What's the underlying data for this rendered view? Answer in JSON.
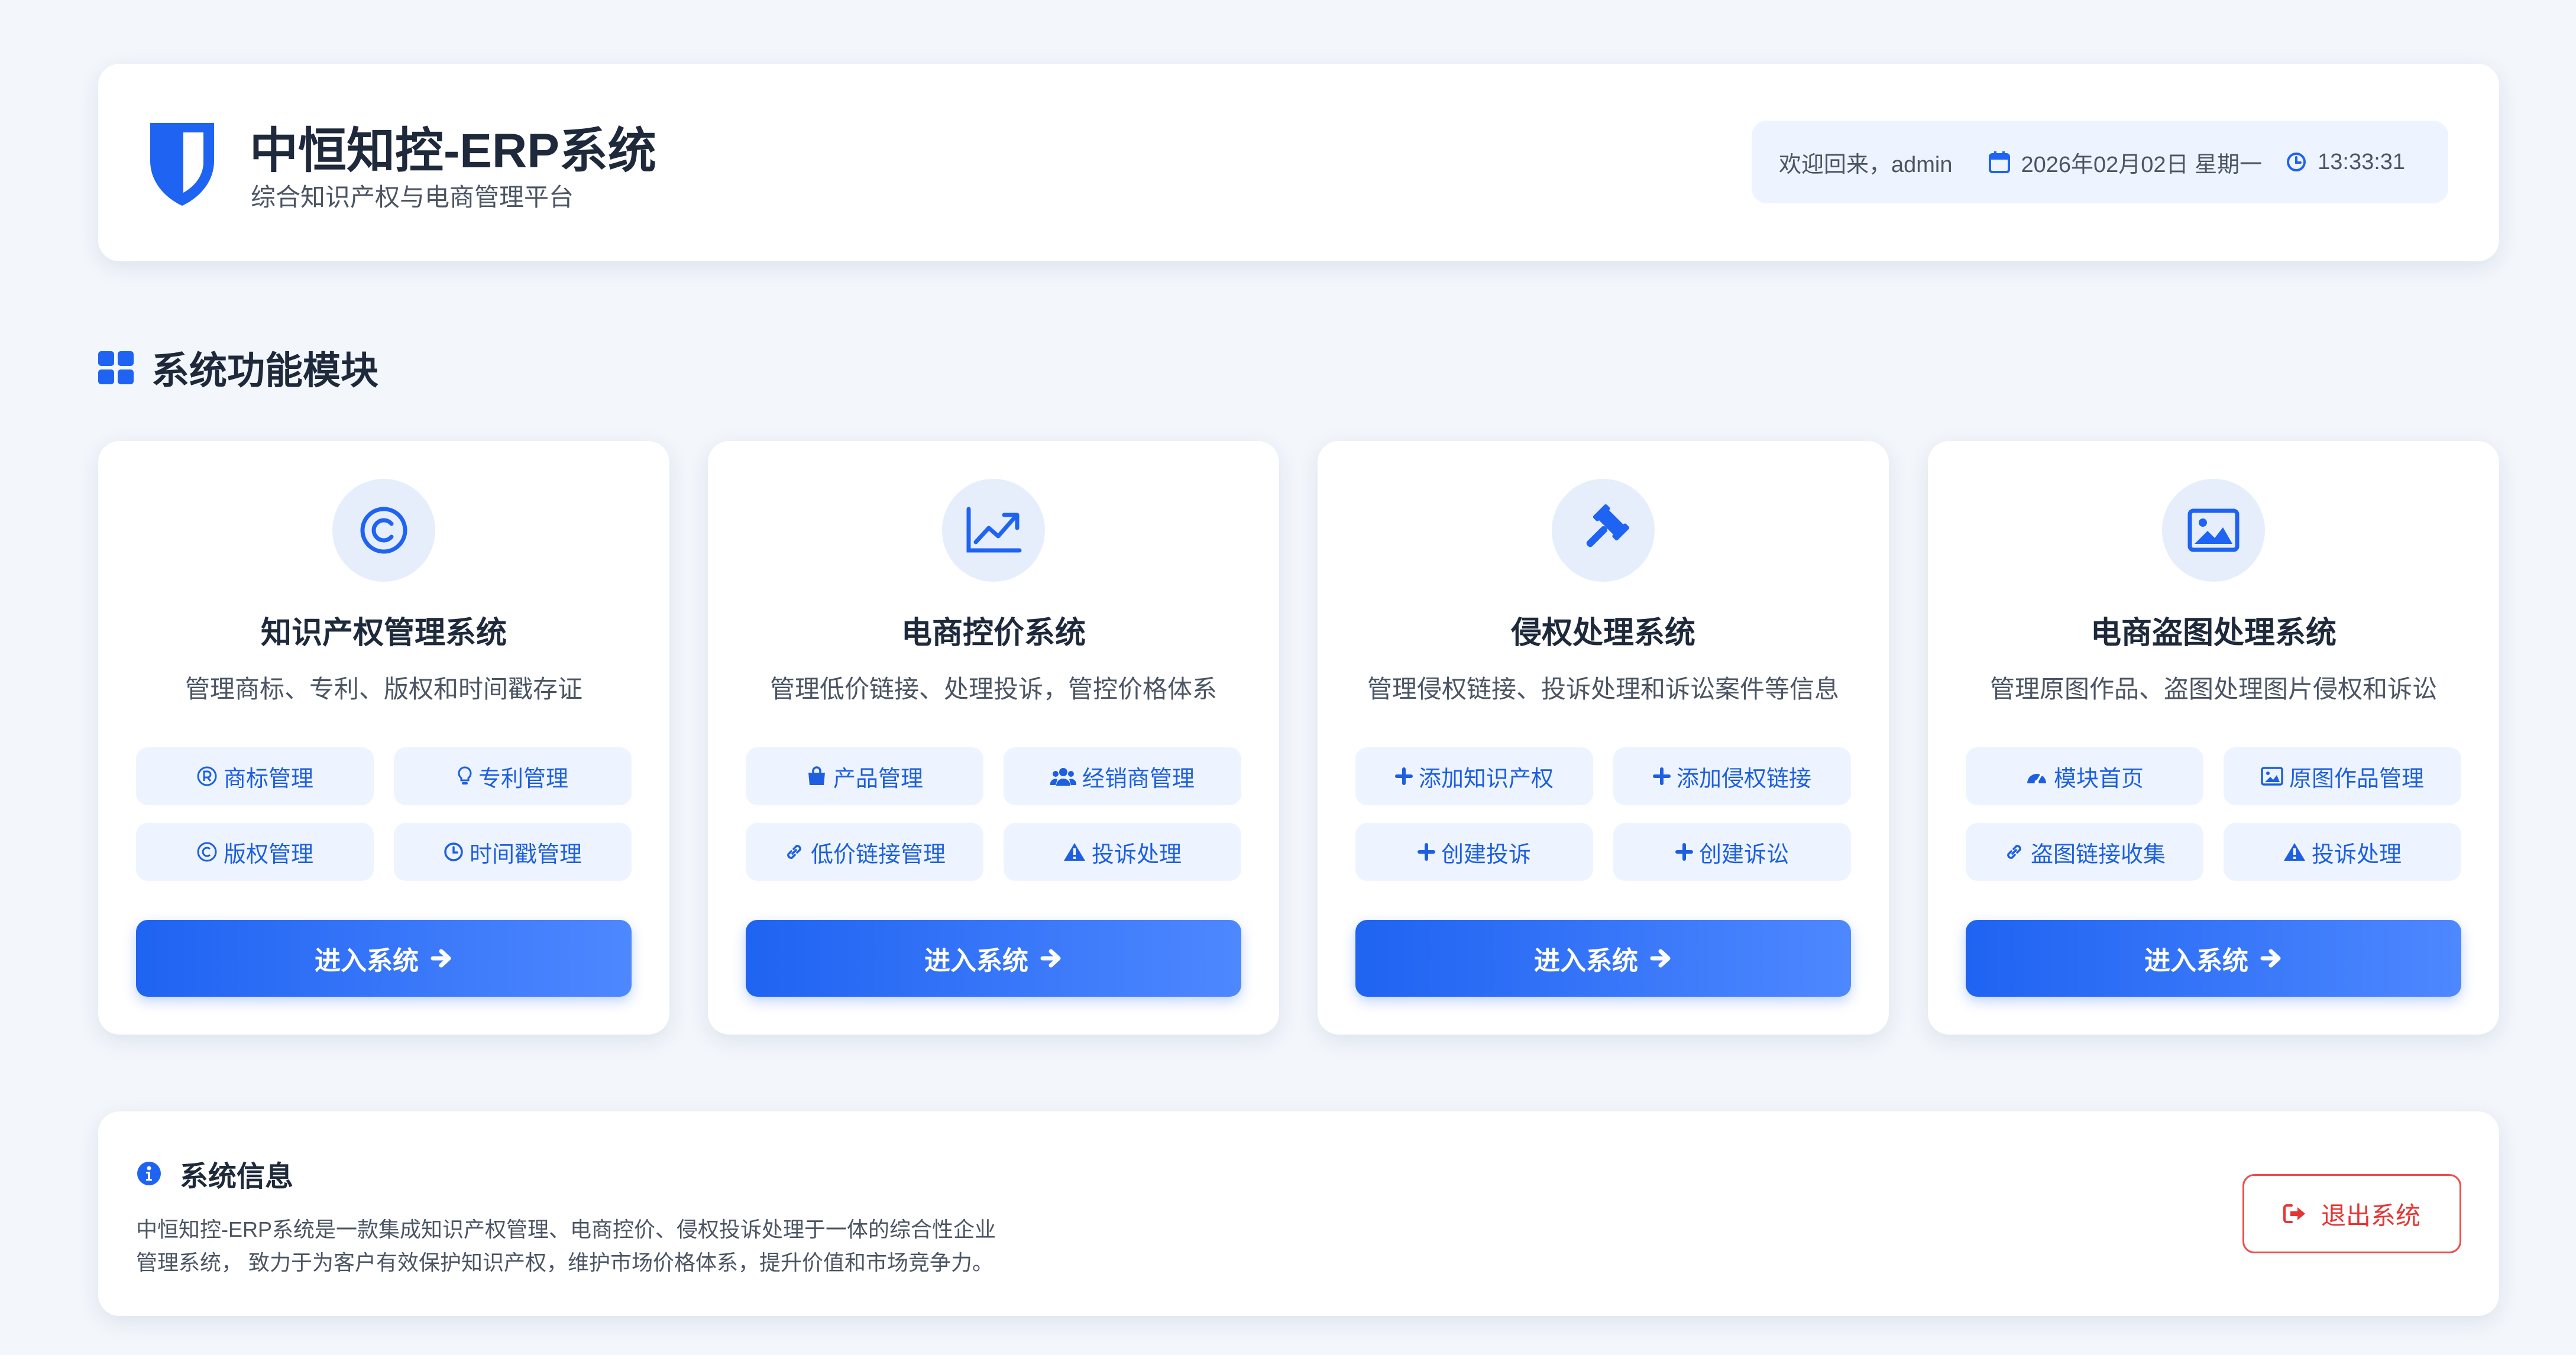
{
  "colors": {
    "accent": "#1f63f2",
    "danger": "#e53535",
    "background": "#f3f6fb"
  },
  "header": {
    "logo_icon": "shield-icon",
    "title": "中恒知控-ERP系统",
    "subtitle": "综合知识产权与电商管理平台",
    "welcome": "欢迎回来，admin",
    "date": "2026年02月02日 星期一",
    "time": "13:33:31"
  },
  "section": {
    "icon": "grid-icon",
    "title": "系统功能模块"
  },
  "modules": [
    {
      "icon": "copyright-icon",
      "title": "知识产权管理系统",
      "desc": "管理商标、专利、版权和时间戳存证",
      "chips": [
        {
          "icon": "registered-icon",
          "label": "商标管理"
        },
        {
          "icon": "lightbulb-icon",
          "label": "专利管理"
        },
        {
          "icon": "copyright-icon",
          "label": "版权管理"
        },
        {
          "icon": "clock-icon",
          "label": "时间戳管理"
        }
      ],
      "button": "进入系统"
    },
    {
      "icon": "chart-line-icon",
      "title": "电商控价系统",
      "desc": "管理低价链接、处理投诉，管控价格体系",
      "chips": [
        {
          "icon": "shopping-bag-icon",
          "label": "产品管理"
        },
        {
          "icon": "users-icon",
          "label": "经销商管理"
        },
        {
          "icon": "link-icon",
          "label": "低价链接管理"
        },
        {
          "icon": "warning-icon",
          "label": "投诉处理"
        }
      ],
      "button": "进入系统"
    },
    {
      "icon": "gavel-icon",
      "title": "侵权处理系统",
      "desc": "管理侵权链接、投诉处理和诉讼案件等信息",
      "chips": [
        {
          "icon": "plus-icon",
          "label": "添加知识产权"
        },
        {
          "icon": "plus-icon",
          "label": "添加侵权链接"
        },
        {
          "icon": "plus-icon",
          "label": "创建投诉"
        },
        {
          "icon": "plus-icon",
          "label": "创建诉讼"
        }
      ],
      "button": "进入系统"
    },
    {
      "icon": "image-icon",
      "title": "电商盗图处理系统",
      "desc": "管理原图作品、盗图处理图片侵权和诉讼",
      "chips": [
        {
          "icon": "dashboard-icon",
          "label": "模块首页"
        },
        {
          "icon": "image-icon",
          "label": "原图作品管理"
        },
        {
          "icon": "link-icon",
          "label": "盗图链接收集"
        },
        {
          "icon": "warning-icon",
          "label": "投诉处理"
        }
      ],
      "button": "进入系统"
    }
  ],
  "info": {
    "icon": "info-icon",
    "title": "系统信息",
    "line1": "中恒知控-ERP系统是一款集成知识产权管理、电商控价、侵权投诉处理于一体的综合性企业",
    "line2": "管理系统， 致力于为客户有效保护知识产权，维护市场价格体系，提升价值和市场竞争力。",
    "logout": "退出系统",
    "logout_icon": "sign-out-icon"
  }
}
